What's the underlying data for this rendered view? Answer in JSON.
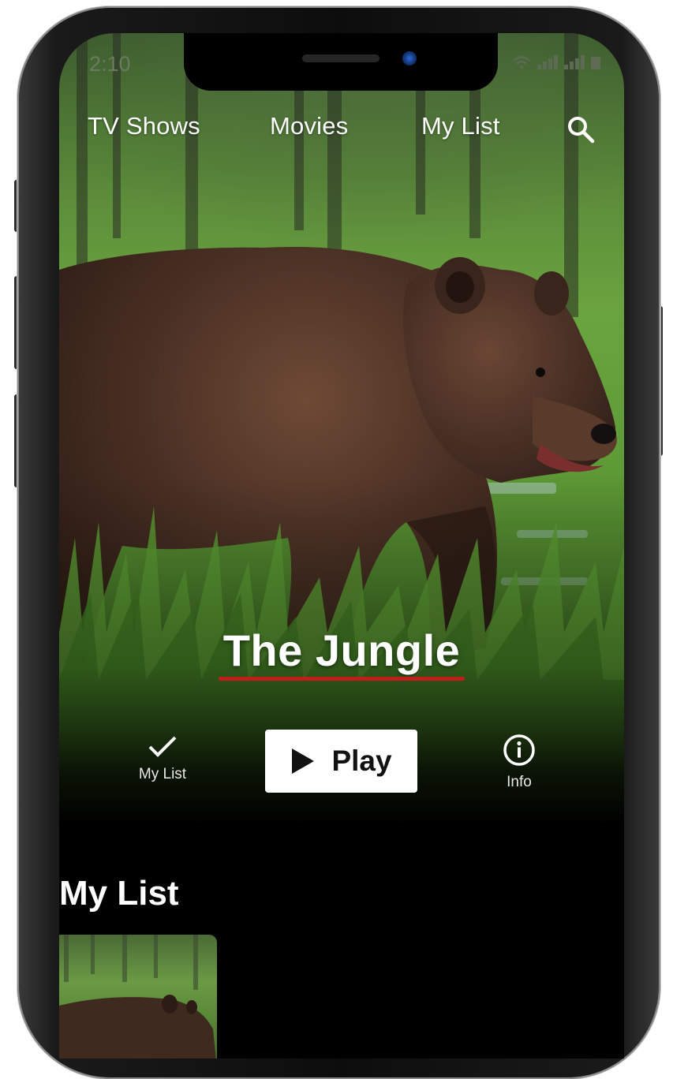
{
  "status_bar": {
    "time": "2:10"
  },
  "nav": {
    "items": [
      {
        "label": "TV Shows"
      },
      {
        "label": "Movies"
      },
      {
        "label": "My List"
      }
    ],
    "search_icon": "search-icon"
  },
  "hero": {
    "title": "The Jungle",
    "accent_color": "#c41b1b",
    "actions": {
      "my_list_label": "My List",
      "play_label": "Play",
      "info_label": "Info"
    }
  },
  "sections": [
    {
      "title": "My List"
    }
  ],
  "icons": {
    "my_list": "check-icon",
    "play": "play-icon",
    "info": "info-icon",
    "search": "search-icon"
  }
}
